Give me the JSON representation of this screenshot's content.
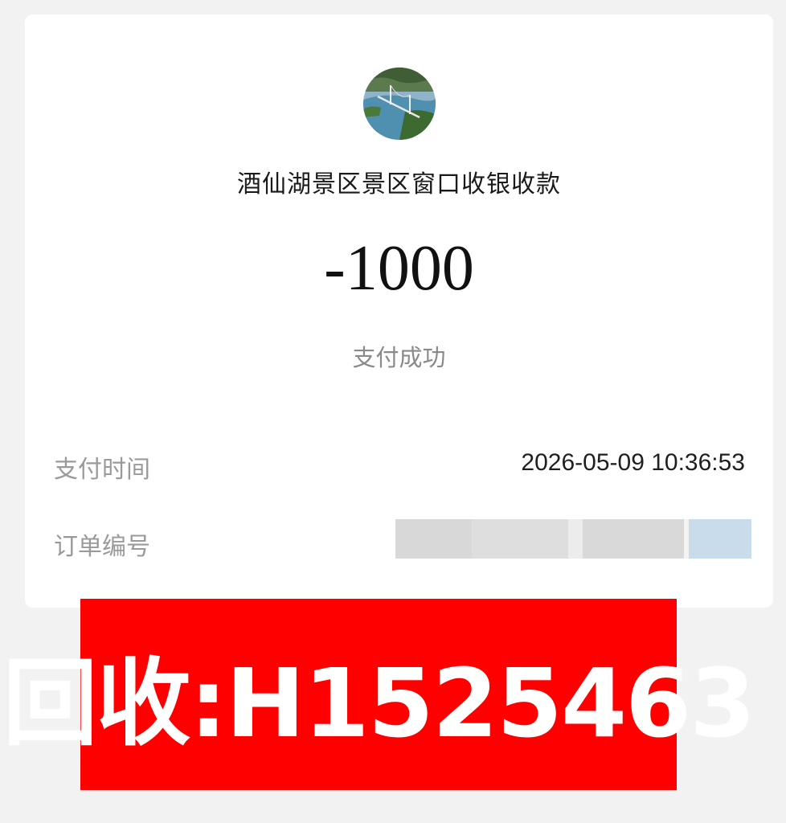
{
  "receipt": {
    "merchant_name": "酒仙湖景区景区窗口收银收款",
    "amount": "-1000",
    "status": "支付成功",
    "avatar_icon": "scenic-bridge-lake-avatar",
    "details": [
      {
        "label": "支付时间",
        "value": "2026-05-09 10:36:53"
      },
      {
        "label": "订单编号",
        "value": ""
      }
    ]
  },
  "banner": {
    "text": "回收:H1525463",
    "background_color": "#fe0000",
    "text_color": "#ffffff"
  }
}
